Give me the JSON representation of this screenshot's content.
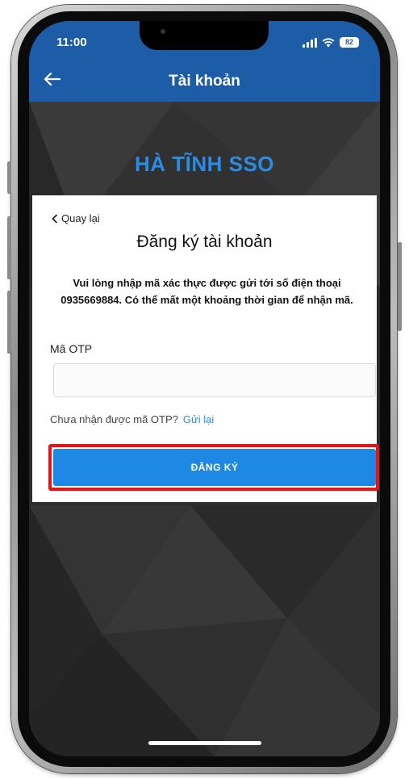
{
  "status_bar": {
    "time": "11:00",
    "battery": "82"
  },
  "nav": {
    "title": "Tài khoản",
    "back_icon": "arrow-left-icon"
  },
  "brand": {
    "text": "HÀ TĨNH SSO"
  },
  "form": {
    "back_label": "Quay lại",
    "title": "Đăng ký tài khoản",
    "description": "Vui lòng nhập mã xác thực được gửi tới số điện thoại 0935669884. Có thể mất một khoảng thời gian để nhận mã.",
    "otp_label": "Mã OTP",
    "otp_value": "",
    "resend_prompt": "Chưa nhận được mã OTP?",
    "resend_link": "Gửi lại",
    "submit_label": "ĐĂNG KÝ"
  },
  "colors": {
    "header": "#1d5da8",
    "brand": "#2b8ce6",
    "button": "#1e88e5",
    "highlight": "#e0161c",
    "background": "#2e2e2e"
  }
}
